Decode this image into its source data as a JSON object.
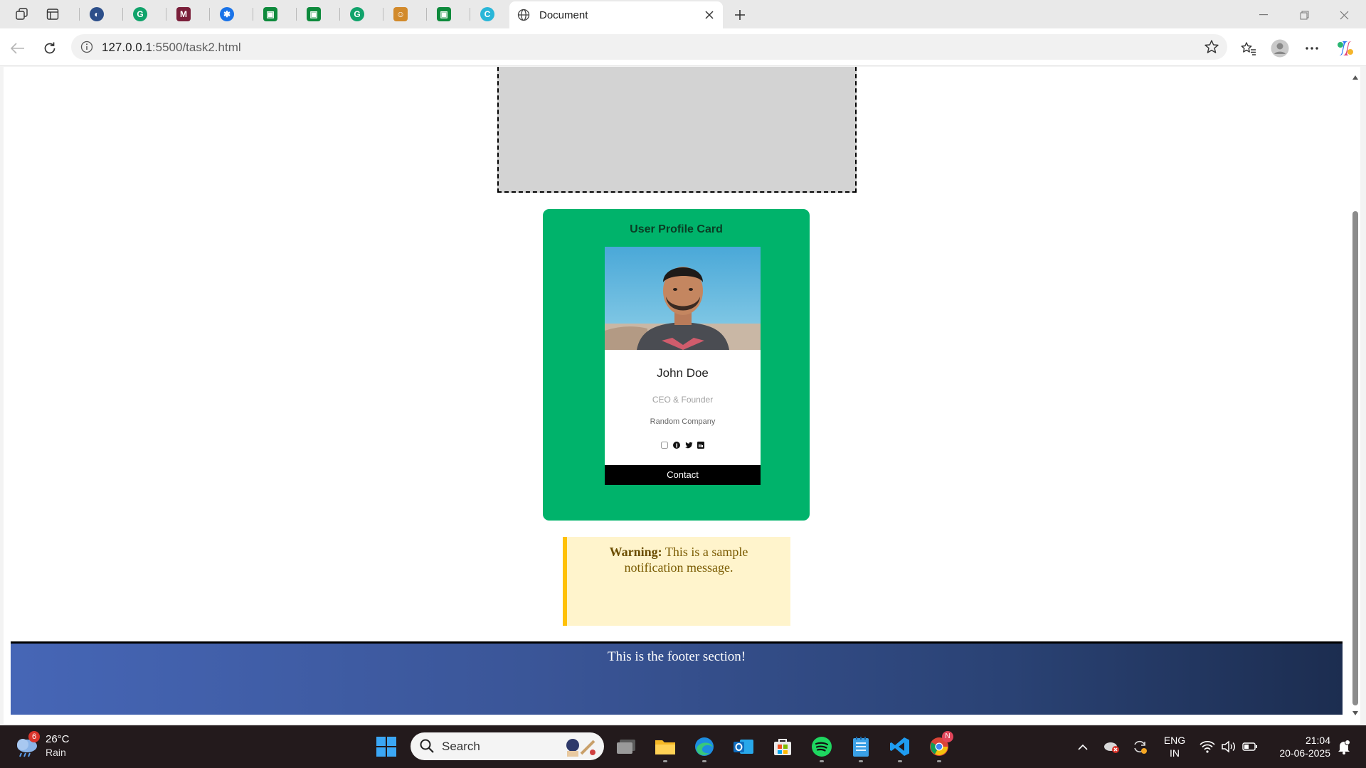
{
  "browser": {
    "tab_title": "Document",
    "url_host": "127.0.0.1",
    "url_rest": ":5500/task2.html"
  },
  "page": {
    "profile_title": "User Profile Card",
    "card": {
      "name": "John Doe",
      "role": "CEO & Founder",
      "company": "Random Company",
      "contact_label": "Contact"
    },
    "warning": {
      "label": "Warning:",
      "message": "This is a sample notification message."
    },
    "footer_text": "This is the footer section!"
  },
  "taskbar": {
    "weather_temp": "26°C",
    "weather_cond": "Rain",
    "weather_badge": "6",
    "search_label": "Search",
    "lang_line1": "ENG",
    "lang_line2": "IN",
    "time": "21:04",
    "date": "20-06-2025",
    "chrome_badge": "N"
  },
  "colors": {
    "profile_panel": "#00b36b",
    "warning_bg": "#fff4cc",
    "warning_border": "#ffc107",
    "footer_gradient_start": "#4666b6",
    "footer_gradient_end": "#1c2d50"
  }
}
